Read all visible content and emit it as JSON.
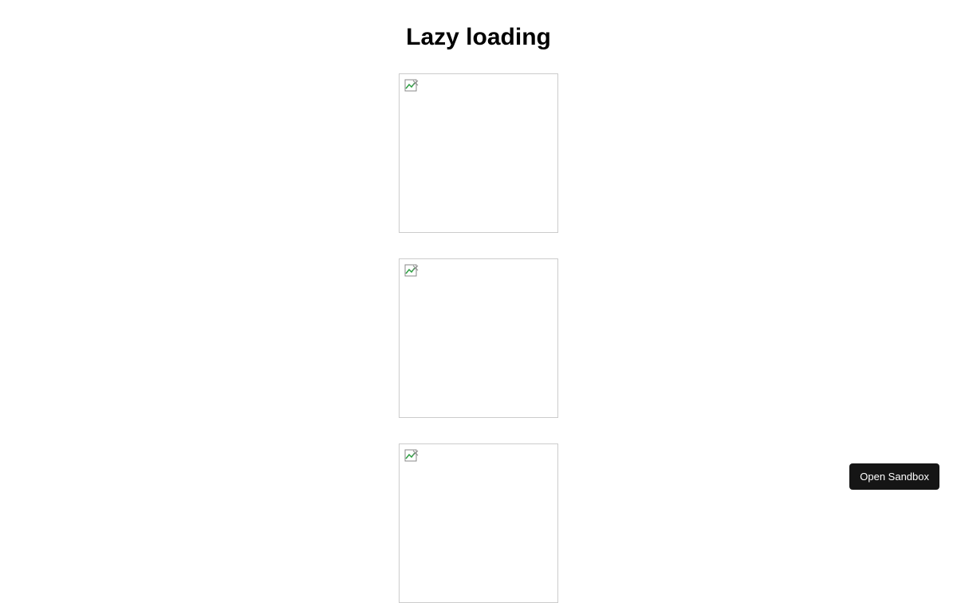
{
  "page": {
    "title": "Lazy loading"
  },
  "images": [
    {
      "alt": "broken-image"
    },
    {
      "alt": "broken-image"
    },
    {
      "alt": "broken-image"
    }
  ],
  "footer": {
    "sandbox_button": "Open Sandbox"
  }
}
